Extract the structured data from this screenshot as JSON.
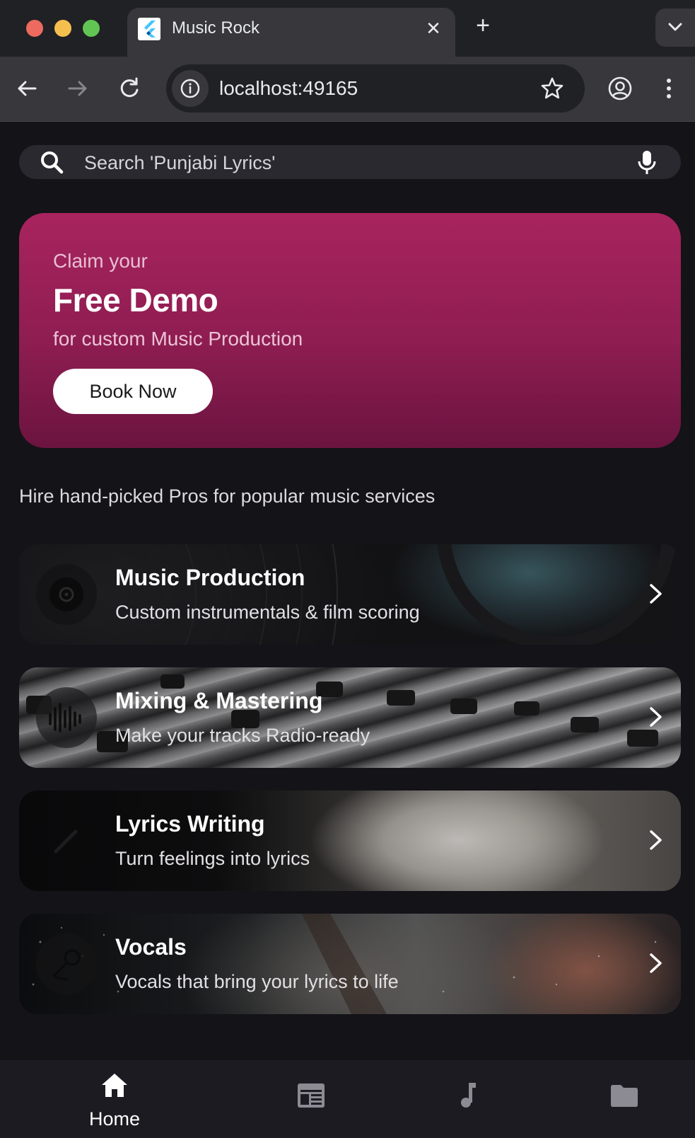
{
  "browser": {
    "tab_title": "Music Rock",
    "tab_close_glyph": "✕",
    "new_tab_glyph": "+",
    "url": "localhost:49165",
    "icons": [
      "back-arrow-icon",
      "forward-arrow-icon",
      "reload-icon",
      "site-info-icon",
      "bookmark-star-icon",
      "profile-icon",
      "more-vert-icon",
      "tab-search-chevron-icon"
    ]
  },
  "search": {
    "placeholder": "Search 'Punjabi Lyrics'",
    "icons": [
      "search-icon",
      "mic-icon"
    ]
  },
  "promo": {
    "kicker": "Claim your",
    "title": "Free Demo",
    "subtitle": "for custom Music Production",
    "button_label": "Book Now",
    "colors": {
      "top": "#a8245e",
      "bottom": "#6b1440"
    }
  },
  "section_heading": "Hire hand-picked Pros for popular music services",
  "services": [
    {
      "title": "Music Production",
      "subtitle": "Custom instrumentals & film scoring",
      "icon": "vinyl-record-icon"
    },
    {
      "title": "Mixing & Mastering",
      "subtitle": "Make your tracks Radio-ready",
      "icon": "sound-wave-icon"
    },
    {
      "title": "Lyrics Writing",
      "subtitle": "Turn feelings into lyrics",
      "icon": "pen-icon"
    },
    {
      "title": "Vocals",
      "subtitle": "Vocals that bring your lyrics to life",
      "icon": "microphone-icon"
    }
  ],
  "bottom_nav": {
    "items": [
      {
        "label": "Home",
        "icon": "home-icon",
        "active": true
      },
      {
        "label": "",
        "icon": "newspaper-icon",
        "active": false
      },
      {
        "label": "",
        "icon": "music-note-icon",
        "active": false
      },
      {
        "label": "",
        "icon": "folder-icon",
        "active": false
      }
    ]
  },
  "theme": {
    "background": "#141318",
    "accent": "#a8245e"
  }
}
